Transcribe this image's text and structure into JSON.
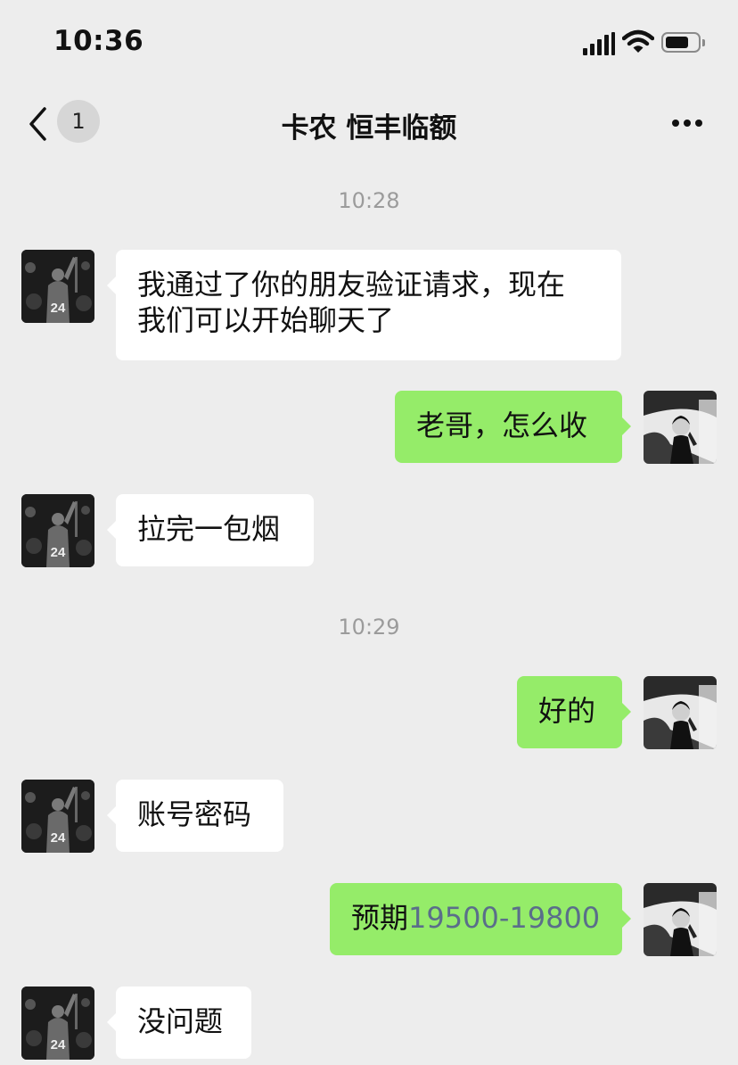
{
  "status_bar": {
    "time": "10:36"
  },
  "nav": {
    "unread_count": "1",
    "title": "卡农 恒丰临额"
  },
  "icons": {
    "back": "chevron-left-icon",
    "more": "more-dots-icon",
    "signal": "signal-icon",
    "wifi": "wifi-icon",
    "battery": "battery-icon"
  },
  "colors": {
    "background": "#ededed",
    "incoming_bubble": "#ffffff",
    "outgoing_bubble": "#95ec69",
    "timestamp": "#9b9b9b"
  },
  "timestamps": [
    "10:28",
    "10:29"
  ],
  "messages": [
    {
      "side": "incoming",
      "text_line1": "我通过了你的朋友验证请求，现在",
      "text_line2": "我们可以开始聊天了"
    },
    {
      "side": "outgoing",
      "text": "老哥，怎么收"
    },
    {
      "side": "incoming",
      "text": "拉完一包烟"
    },
    {
      "side": "outgoing",
      "text": "好的"
    },
    {
      "side": "incoming",
      "text": "账号密码"
    },
    {
      "side": "outgoing",
      "text_prefix": "预期",
      "text_number": "19500-19800"
    },
    {
      "side": "incoming",
      "text": "没问题"
    }
  ]
}
